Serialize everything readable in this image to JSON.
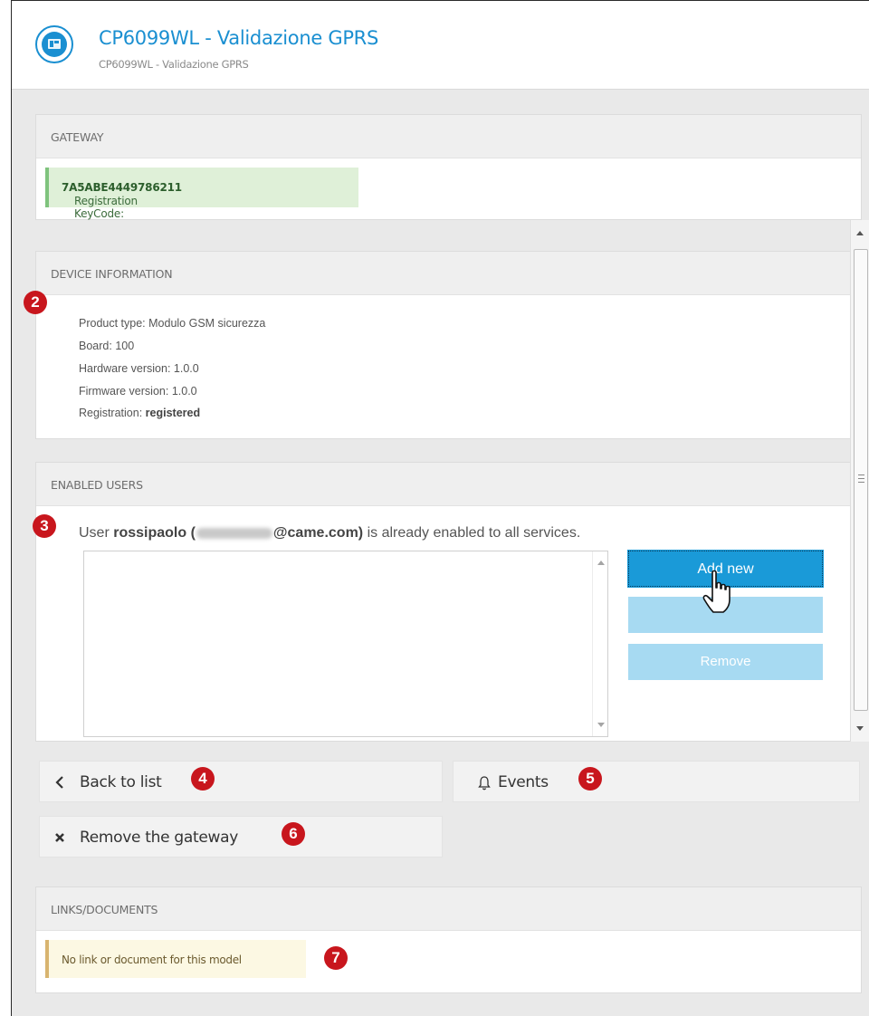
{
  "header": {
    "title": "CP6099WL - Validazione GPRS",
    "subtitle": "CP6099WL - Validazione GPRS",
    "logo_icon": "gateway-device-icon"
  },
  "gateway": {
    "heading": "GATEWAY",
    "keycode_label": "Registration KeyCode:",
    "keycode_value": "7A5ABE4449786211"
  },
  "device_info": {
    "heading": "DEVICE INFORMATION",
    "lines": [
      {
        "label": "Product type:",
        "value": "Modulo GSM sicurezza"
      },
      {
        "label": "Board:",
        "value": "100"
      },
      {
        "label": "Hardware version:",
        "value": "1.0.0"
      },
      {
        "label": "Firmware version:",
        "value": "1.0.0"
      },
      {
        "label": "Registration:",
        "value": "registered"
      }
    ]
  },
  "enabled_users": {
    "heading": "ENABLED USERS",
    "message_prefix": "User",
    "username": "rossipaolo",
    "email_suffix": "@came.com",
    "message_suffix": "is already enabled to all services.",
    "buttons": {
      "add": "Add new",
      "edit": "",
      "remove": "Remove"
    }
  },
  "actions": {
    "back": "Back to list",
    "events": "Events",
    "remove_gateway": "Remove the gateway"
  },
  "links": {
    "heading": "LINKS/DOCUMENTS",
    "empty_message": "No link or document for this model"
  },
  "callouts": [
    "2",
    "3",
    "4",
    "5",
    "6",
    "7"
  ],
  "colors": {
    "accent": "#1a9ad8",
    "callout": "#c8161d",
    "success_bg": "#dff0d8",
    "warning_bg": "#fcf8e3"
  }
}
